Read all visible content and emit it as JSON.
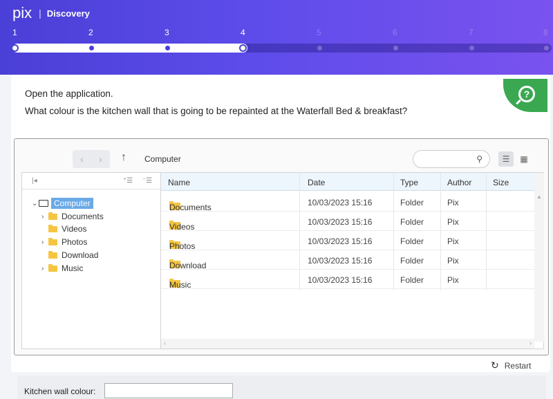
{
  "app": {
    "logo": "pix",
    "separator": "|",
    "title": "Discovery"
  },
  "progress": {
    "steps": [
      "1",
      "2",
      "3",
      "4",
      "5",
      "6",
      "7",
      "8"
    ],
    "current_step": 4,
    "total_steps": 8
  },
  "question": {
    "line1": "Open the application.",
    "line2": "What colour is the kitchen wall that is going to be repainted at the Waterfall Bed & breakfast?",
    "badge_icon": "magnifier-question-icon",
    "badge_symbol": "?"
  },
  "explorer": {
    "path": "Computer",
    "toolbar_icons": {
      "back": "‹",
      "forward": "›",
      "up": "↑",
      "search": "search-icon",
      "list_view": "list-view-icon",
      "grid_view": "grid-view-icon"
    },
    "tree": {
      "root": "Computer",
      "items": [
        {
          "label": "Documents",
          "has_children": true
        },
        {
          "label": "Videos",
          "has_children": false
        },
        {
          "label": "Photos",
          "has_children": true
        },
        {
          "label": "Download",
          "has_children": false
        },
        {
          "label": "Music",
          "has_children": true
        }
      ]
    },
    "columns": [
      "Name",
      "Date",
      "Type",
      "Author",
      "Size"
    ],
    "rows": [
      {
        "name": "Documents",
        "date": "10/03/2023 15:16",
        "type": "Folder",
        "author": "Pix",
        "size": ""
      },
      {
        "name": "Videos",
        "date": "10/03/2023 15:16",
        "type": "Folder",
        "author": "Pix",
        "size": ""
      },
      {
        "name": "Photos",
        "date": "10/03/2023 15:16",
        "type": "Folder",
        "author": "Pix",
        "size": ""
      },
      {
        "name": "Download",
        "date": "10/03/2023 15:16",
        "type": "Folder",
        "author": "Pix",
        "size": ""
      },
      {
        "name": "Music",
        "date": "10/03/2023 15:16",
        "type": "Folder",
        "author": "Pix",
        "size": ""
      }
    ]
  },
  "restart_label": "Restart",
  "answer": {
    "label": "Kitchen wall colour:",
    "value": "",
    "placeholder": ""
  },
  "colors": {
    "header_start": "#4a3fd6",
    "header_end": "#7a52ef",
    "badge": "#3aa851",
    "selection": "#6aa9e6",
    "folder": "#f5c542"
  }
}
